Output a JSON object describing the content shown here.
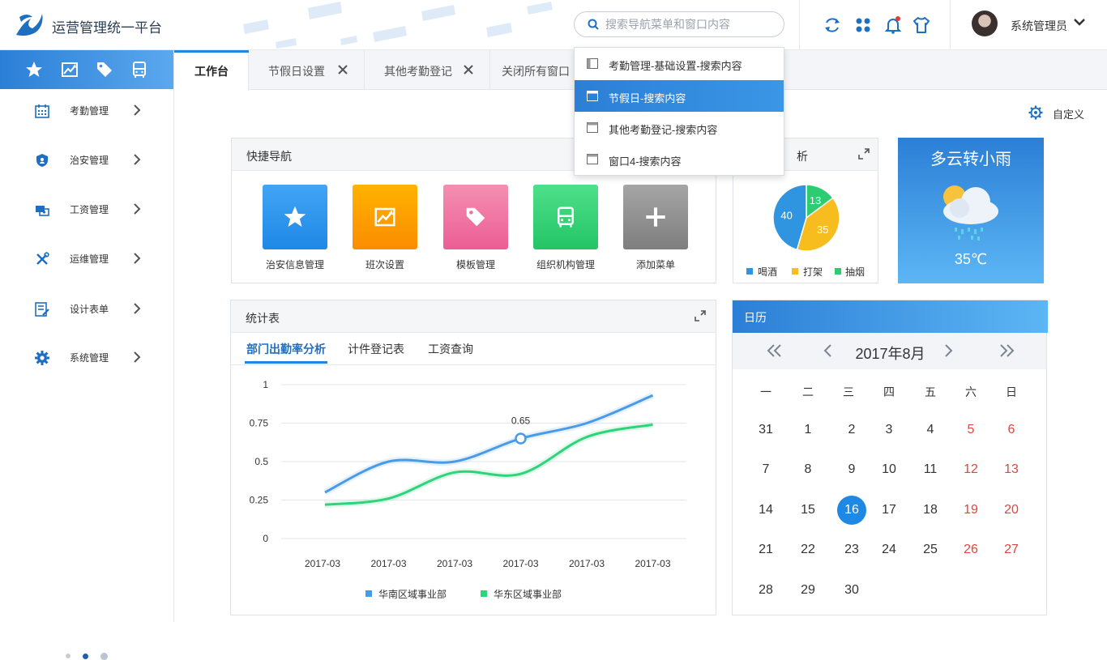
{
  "app": {
    "title": "运营管理统一平台"
  },
  "search": {
    "placeholder": "搜索导航菜单和窗口内容"
  },
  "user": {
    "name": "系统管理员"
  },
  "sidebar": {
    "items": [
      {
        "label": "考勤管理",
        "icon": "calendar-icon"
      },
      {
        "label": "治安管理",
        "icon": "shield-icon"
      },
      {
        "label": "工资管理",
        "icon": "salary-icon"
      },
      {
        "label": "运维管理",
        "icon": "tools-icon"
      },
      {
        "label": "设计表单",
        "icon": "form-edit-icon"
      },
      {
        "label": "系统管理",
        "icon": "gear-icon"
      }
    ],
    "tabs": [
      "star-icon",
      "trend-icon",
      "tag-icon",
      "bus-icon"
    ]
  },
  "tabs": [
    {
      "label": "工作台",
      "closable": false
    },
    {
      "label": "节假日设置",
      "closable": true
    },
    {
      "label": "其他考勤登记",
      "closable": true
    },
    {
      "label": "关闭所有窗口",
      "closable": false
    }
  ],
  "dropdown": {
    "items": [
      {
        "label": "考勤管理-基础设置-搜索内容",
        "active": false
      },
      {
        "label": "节假日-搜索内容",
        "active": true
      },
      {
        "label": "其他考勤登记-搜索内容",
        "active": false
      },
      {
        "label": "窗口4-搜索内容",
        "active": false
      }
    ]
  },
  "custom": {
    "label": "自定义"
  },
  "quick_nav": {
    "title": "快捷导航",
    "items": [
      {
        "label": "治安信息管理",
        "icon": "star-icon",
        "color": "#2196f3"
      },
      {
        "label": "班次设置",
        "icon": "trend-icon",
        "color": "#ff9800"
      },
      {
        "label": "模板管理",
        "icon": "tag-icon",
        "color": "#f06292"
      },
      {
        "label": "组织机构管理",
        "icon": "bus-icon",
        "color": "#2ecc71"
      },
      {
        "label": "添加菜单",
        "icon": "plus-icon",
        "color": "#8e8e8e"
      }
    ]
  },
  "analysis": {
    "title_fragment": "析",
    "chart_data": {
      "type": "pie",
      "categories": [
        "喝酒",
        "打架",
        "抽烟"
      ],
      "values": [
        40,
        35,
        13
      ],
      "colors": [
        "#2f95e0",
        "#f7bd1f",
        "#2ecc71"
      ],
      "legend": "bottom"
    }
  },
  "weather": {
    "desc": "多云转小雨",
    "temp": "35℃",
    "icon": "cloud-rain-icon"
  },
  "stats": {
    "title": "统计表",
    "tabs": [
      "部门出勤率分析",
      "计件登记表",
      "工资查询"
    ],
    "active_tab": 0,
    "chart_data": {
      "type": "line",
      "x": [
        "2017-03",
        "2017-03",
        "2017-03",
        "2017-03",
        "2017-03",
        "2017-03"
      ],
      "ylim": [
        0,
        1
      ],
      "yticks": [
        "0",
        "0.25",
        "0.5",
        "0.75",
        "1"
      ],
      "grid": true,
      "legend": "bottom",
      "series": [
        {
          "name": "华南区域事业部",
          "color": "#4a9be6",
          "values": [
            0.3,
            0.5,
            0.5,
            0.65,
            0.75,
            0.93
          ]
        },
        {
          "name": "华东区域事业部",
          "color": "#2ed47a",
          "values": [
            0.22,
            0.26,
            0.43,
            0.42,
            0.66,
            0.74
          ]
        }
      ],
      "highlight": {
        "series": 0,
        "index": 3,
        "label": "0.65"
      }
    }
  },
  "calendar": {
    "title": "日历",
    "month": "2017年8月",
    "weekdays": [
      "一",
      "二",
      "三",
      "四",
      "五",
      "六",
      "日"
    ],
    "weeks": [
      [
        "31",
        "1",
        "2",
        "3",
        "4",
        "5",
        "6"
      ],
      [
        "7",
        "8",
        "9",
        "10",
        "11",
        "12",
        "13"
      ],
      [
        "14",
        "15",
        "16",
        "17",
        "18",
        "19",
        "20"
      ],
      [
        "21",
        "22",
        "23",
        "24",
        "25",
        "26",
        "27"
      ],
      [
        "28",
        "29",
        "30",
        "",
        "",
        "",
        ""
      ]
    ],
    "today": "16",
    "weekend_color": "#e0463e",
    "accent": "#1e88e5"
  },
  "colors": {
    "brand": "#1e88e5",
    "nav_gradient": [
      "#2b7fd6",
      "#5aa8ee"
    ]
  }
}
